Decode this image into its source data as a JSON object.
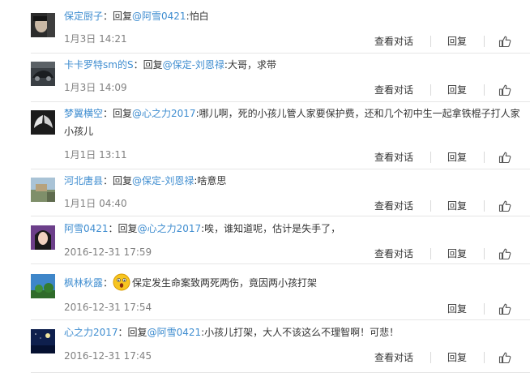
{
  "comments": [
    {
      "user": "保定厨子",
      "sep": "：回复",
      "mention": "@阿雪0421",
      "text": ":怕白",
      "time": "1月3日 14:21",
      "dialog": "查看对话",
      "reply": "回复",
      "avatar_icon": "portrait-dark-avatar"
    },
    {
      "user": "卡卡罗特sm的S",
      "sep": "：回复",
      "mention": "@保定-刘恩禄",
      "text": ":大哥，求带",
      "time": "1月3日 14:09",
      "dialog": "查看对话",
      "reply": "回复",
      "avatar_icon": "car-avatar"
    },
    {
      "user": "梦翼横空",
      "sep": "：回复",
      "mention": "@心之力2017",
      "text": ":哪儿啊，死的小孩儿管人家要保护费，还和几个初中生一起拿铁棍子打人家小孩儿",
      "time": "1月1日 13:11",
      "dialog": "查看对话",
      "reply": "回复",
      "avatar_icon": "wings-avatar"
    },
    {
      "user": "河北唐县",
      "sep": "：回复",
      "mention": "@保定-刘恩禄",
      "text": ":啥意思",
      "time": "1月1日 04:40",
      "dialog": "查看对话",
      "reply": "回复",
      "avatar_icon": "landscape-avatar"
    },
    {
      "user": "阿雪0421",
      "sep": "：回复",
      "mention": "@心之力2017",
      "text": ":唉，谁知道呢，估计是失手了，",
      "time": "2016-12-31 17:59",
      "dialog": "查看对话",
      "reply": "回复",
      "avatar_icon": "girl-avatar"
    },
    {
      "user": "枫林秋露",
      "sep": "：",
      "mention": "",
      "text": "保定发生命案致两死两伤，竟因两小孩打架",
      "time": "2016-12-31 17:54",
      "dialog": "",
      "reply": "回复",
      "avatar_icon": "sky-avatar",
      "emoji": "surprised-emoji"
    },
    {
      "user": "心之力2017",
      "sep": "：回复",
      "mention": "@阿雪0421",
      "text": ":小孩儿打架，大人不该这么不理智啊！可悲！",
      "time": "2016-12-31 17:45",
      "dialog": "查看对话",
      "reply": "回复",
      "avatar_icon": "night-avatar"
    }
  ],
  "colors": {
    "link": "#3f8dd0",
    "text": "#333333",
    "time": "#808080",
    "divider": "#e6e6e6"
  }
}
